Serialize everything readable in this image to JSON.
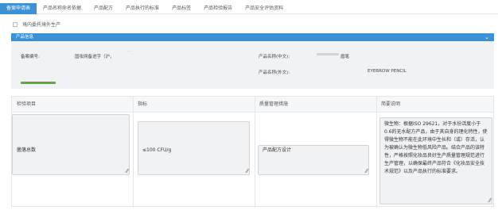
{
  "tabs": [
    {
      "label": "备案申请表",
      "active": true
    },
    {
      "label": "产品名称命名依据",
      "active": false
    },
    {
      "label": "产品配方",
      "active": false
    },
    {
      "label": "产品执行的标准",
      "active": false
    },
    {
      "label": "产品标签",
      "active": false
    },
    {
      "label": "产品检验报告",
      "active": false
    },
    {
      "label": "产品安全评估资料",
      "active": false
    }
  ],
  "checkbox_label": "境内委托境外生产",
  "section_title": "产品信息",
  "info": {
    "reg_no_label": "备案编号:",
    "reg_no_value": "国妆网备进字（沪，",
    "name_cn_label": "产品名称(中文):",
    "name_cn_value": "",
    "name_cn_suffix": "眉笔",
    "name_en_label": "产品名称(外文):",
    "name_en_value": "EYEBROW PENCIL"
  },
  "table": {
    "headers": [
      "检验项目",
      "指标",
      "质量管理措施",
      "简要说明"
    ],
    "row": {
      "item": "菌落总数",
      "indicator": "≤100 CFU/g",
      "measure": "产品配方设计",
      "note": "微生物：根据ISO 29621，对于水份活度小于0.6的无水配方产品，由于其自身的理化特性，使得微生物不能在此环境中生长和（或）存活，认为被确认为微生物低风险产品。结合产品的该特性，严格按照化妆品良好生产质量管理规范进行生产管理，以确保最终产品符合《化妆品安全技术规范》以及产品执行的标准要求。"
    }
  },
  "colors": {
    "accent": "#3c91d6",
    "progress": "#5aad30",
    "field_bg": "#f1f2f4"
  },
  "icons": {
    "collapse": "chevron-down-icon",
    "resize": "resize-grip-icon"
  }
}
